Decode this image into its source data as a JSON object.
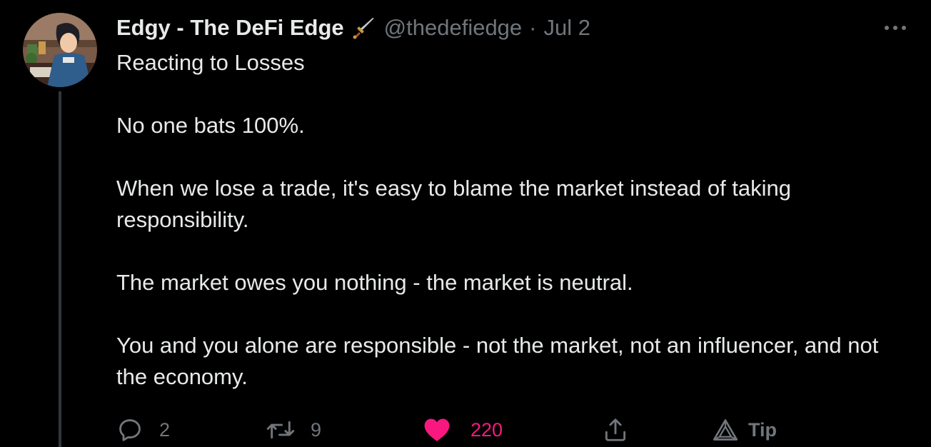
{
  "tweet": {
    "display_name": "Edgy - The DeFi Edge",
    "name_emoji": "dagger-icon",
    "handle": "@thedefiedge",
    "separator": "·",
    "date": "Jul 2",
    "paragraphs": [
      "Reacting to Losses",
      "No one bats 100%.",
      "When we lose a trade, it's easy to blame the market instead of taking responsibility.",
      "The market owes you nothing - the market is neutral.",
      "You and you alone are responsible - not the market, not an influencer, and not the economy."
    ]
  },
  "actions": {
    "reply_count": "2",
    "retweet_count": "9",
    "like_count": "220",
    "tip_label": "Tip"
  },
  "colors": {
    "background": "#000000",
    "text": "#e7e9ea",
    "muted": "#71767b",
    "like": "#f91880",
    "thread_line": "#333639"
  }
}
